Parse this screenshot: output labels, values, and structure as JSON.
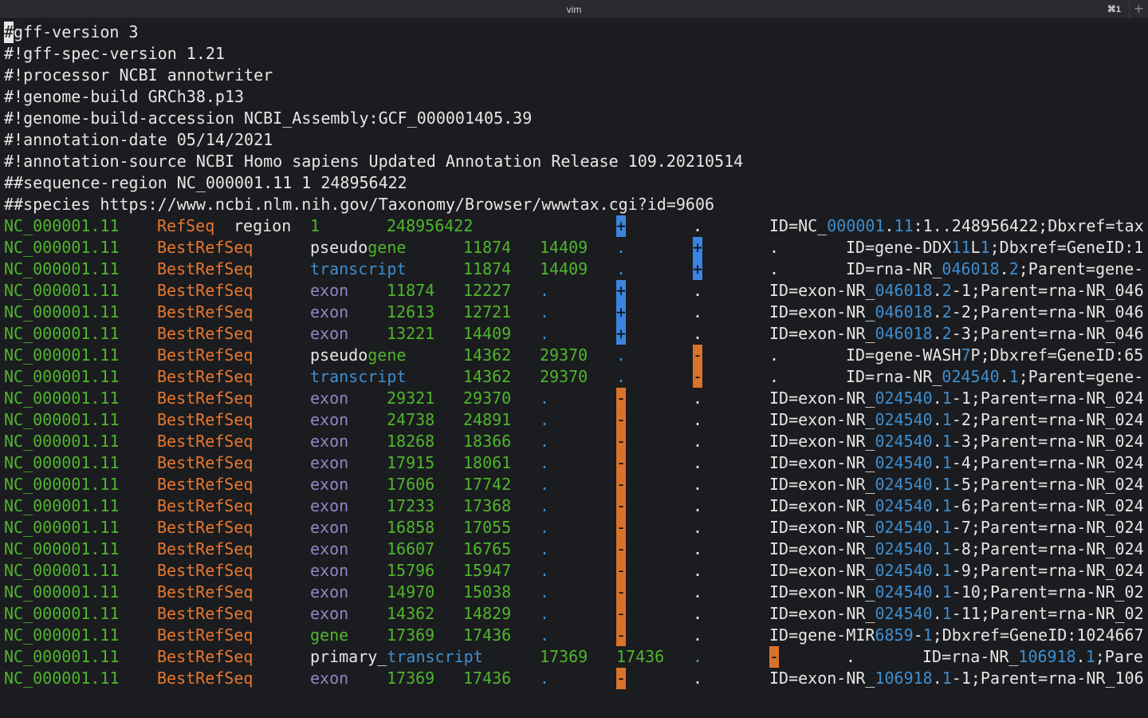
{
  "window": {
    "title": "vim",
    "shortcut": "⌘1",
    "newtab": "+"
  },
  "header_lines": [
    "#gff-version 3",
    "#!gff-spec-version 1.21",
    "#!processor NCBI annotwriter",
    "#!genome-build GRCh38.p13",
    "#!genome-build-accession NCBI_Assembly:GCF_000001405.39",
    "#!annotation-date 05/14/2021",
    "#!annotation-source NCBI Homo sapiens Updated Annotation Release 109.20210514",
    "##sequence-region NC_000001.11 1 248956422",
    "##species https://www.ncbi.nlm.nih.gov/Taxonomy/Browser/wwwtax.cgi?id=9606"
  ],
  "cursor_char": "#",
  "rows": [
    {
      "seqid": "NC_000001.11",
      "source": "RefSeq",
      "type": "region",
      "start": "1",
      "end": "248956422",
      "score": ".",
      "strand": "+",
      "phase": ".",
      "attr_pre": "ID=NC_",
      "attr_num": "000001",
      "attr_mid": ".",
      "attr_num2": "11",
      "attr_post": ":1..248956422;Dbxref=tax",
      "layout": "region"
    },
    {
      "seqid": "NC_000001.11",
      "source": "BestRefSeq",
      "type": "pseudogene",
      "start": "11874",
      "end": "14409",
      "score": ".",
      "strand": "+",
      "phase": ".",
      "attr_pre": "ID=gene-DDX",
      "attr_num": "11",
      "attr_mid": "L",
      "attr_num2": "1",
      "attr_post": ";Dbxref=GeneID:1",
      "layout": "gene"
    },
    {
      "seqid": "NC_000001.11",
      "source": "BestRefSeq",
      "type": "transcript",
      "start": "11874",
      "end": "14409",
      "score": ".",
      "strand": "+",
      "phase": ".",
      "attr_pre": "ID=rna-NR_",
      "attr_num": "046018",
      "attr_mid": ".",
      "attr_num2": "2",
      "attr_post": ";Parent=gene-",
      "layout": "gene"
    },
    {
      "seqid": "NC_000001.11",
      "source": "BestRefSeq",
      "type": "exon",
      "start": "11874",
      "end": "12227",
      "score": ".",
      "strand": "+",
      "phase": ".",
      "attr_pre": "ID=exon-NR_",
      "attr_num": "046018",
      "attr_mid": ".",
      "attr_num2": "2",
      "attr_post": "-1;Parent=rna-NR_046",
      "layout": "exon"
    },
    {
      "seqid": "NC_000001.11",
      "source": "BestRefSeq",
      "type": "exon",
      "start": "12613",
      "end": "12721",
      "score": ".",
      "strand": "+",
      "phase": ".",
      "attr_pre": "ID=exon-NR_",
      "attr_num": "046018",
      "attr_mid": ".",
      "attr_num2": "2",
      "attr_post": "-2;Parent=rna-NR_046",
      "layout": "exon"
    },
    {
      "seqid": "NC_000001.11",
      "source": "BestRefSeq",
      "type": "exon",
      "start": "13221",
      "end": "14409",
      "score": ".",
      "strand": "+",
      "phase": ".",
      "attr_pre": "ID=exon-NR_",
      "attr_num": "046018",
      "attr_mid": ".",
      "attr_num2": "2",
      "attr_post": "-3;Parent=rna-NR_046",
      "layout": "exon"
    },
    {
      "seqid": "NC_000001.11",
      "source": "BestRefSeq",
      "type": "pseudogene",
      "start": "14362",
      "end": "29370",
      "score": ".",
      "strand": "-",
      "phase": ".",
      "attr_pre": "ID=gene-WASH",
      "attr_num": "7",
      "attr_mid": "P",
      "attr_num2": "",
      "attr_post": ";Dbxref=GeneID:65",
      "layout": "gene"
    },
    {
      "seqid": "NC_000001.11",
      "source": "BestRefSeq",
      "type": "transcript",
      "start": "14362",
      "end": "29370",
      "score": ".",
      "strand": "-",
      "phase": ".",
      "attr_pre": "ID=rna-NR_",
      "attr_num": "024540",
      "attr_mid": ".",
      "attr_num2": "1",
      "attr_post": ";Parent=gene-",
      "layout": "gene"
    },
    {
      "seqid": "NC_000001.11",
      "source": "BestRefSeq",
      "type": "exon",
      "start": "29321",
      "end": "29370",
      "score": ".",
      "strand": "-",
      "phase": ".",
      "attr_pre": "ID=exon-NR_",
      "attr_num": "024540",
      "attr_mid": ".",
      "attr_num2": "1",
      "attr_post": "-1;Parent=rna-NR_024",
      "layout": "exon"
    },
    {
      "seqid": "NC_000001.11",
      "source": "BestRefSeq",
      "type": "exon",
      "start": "24738",
      "end": "24891",
      "score": ".",
      "strand": "-",
      "phase": ".",
      "attr_pre": "ID=exon-NR_",
      "attr_num": "024540",
      "attr_mid": ".",
      "attr_num2": "1",
      "attr_post": "-2;Parent=rna-NR_024",
      "layout": "exon"
    },
    {
      "seqid": "NC_000001.11",
      "source": "BestRefSeq",
      "type": "exon",
      "start": "18268",
      "end": "18366",
      "score": ".",
      "strand": "-",
      "phase": ".",
      "attr_pre": "ID=exon-NR_",
      "attr_num": "024540",
      "attr_mid": ".",
      "attr_num2": "1",
      "attr_post": "-3;Parent=rna-NR_024",
      "layout": "exon"
    },
    {
      "seqid": "NC_000001.11",
      "source": "BestRefSeq",
      "type": "exon",
      "start": "17915",
      "end": "18061",
      "score": ".",
      "strand": "-",
      "phase": ".",
      "attr_pre": "ID=exon-NR_",
      "attr_num": "024540",
      "attr_mid": ".",
      "attr_num2": "1",
      "attr_post": "-4;Parent=rna-NR_024",
      "layout": "exon"
    },
    {
      "seqid": "NC_000001.11",
      "source": "BestRefSeq",
      "type": "exon",
      "start": "17606",
      "end": "17742",
      "score": ".",
      "strand": "-",
      "phase": ".",
      "attr_pre": "ID=exon-NR_",
      "attr_num": "024540",
      "attr_mid": ".",
      "attr_num2": "1",
      "attr_post": "-5;Parent=rna-NR_024",
      "layout": "exon"
    },
    {
      "seqid": "NC_000001.11",
      "source": "BestRefSeq",
      "type": "exon",
      "start": "17233",
      "end": "17368",
      "score": ".",
      "strand": "-",
      "phase": ".",
      "attr_pre": "ID=exon-NR_",
      "attr_num": "024540",
      "attr_mid": ".",
      "attr_num2": "1",
      "attr_post": "-6;Parent=rna-NR_024",
      "layout": "exon"
    },
    {
      "seqid": "NC_000001.11",
      "source": "BestRefSeq",
      "type": "exon",
      "start": "16858",
      "end": "17055",
      "score": ".",
      "strand": "-",
      "phase": ".",
      "attr_pre": "ID=exon-NR_",
      "attr_num": "024540",
      "attr_mid": ".",
      "attr_num2": "1",
      "attr_post": "-7;Parent=rna-NR_024",
      "layout": "exon"
    },
    {
      "seqid": "NC_000001.11",
      "source": "BestRefSeq",
      "type": "exon",
      "start": "16607",
      "end": "16765",
      "score": ".",
      "strand": "-",
      "phase": ".",
      "attr_pre": "ID=exon-NR_",
      "attr_num": "024540",
      "attr_mid": ".",
      "attr_num2": "1",
      "attr_post": "-8;Parent=rna-NR_024",
      "layout": "exon"
    },
    {
      "seqid": "NC_000001.11",
      "source": "BestRefSeq",
      "type": "exon",
      "start": "15796",
      "end": "15947",
      "score": ".",
      "strand": "-",
      "phase": ".",
      "attr_pre": "ID=exon-NR_",
      "attr_num": "024540",
      "attr_mid": ".",
      "attr_num2": "1",
      "attr_post": "-9;Parent=rna-NR_024",
      "layout": "exon"
    },
    {
      "seqid": "NC_000001.11",
      "source": "BestRefSeq",
      "type": "exon",
      "start": "14970",
      "end": "15038",
      "score": ".",
      "strand": "-",
      "phase": ".",
      "attr_pre": "ID=exon-NR_",
      "attr_num": "024540",
      "attr_mid": ".",
      "attr_num2": "1",
      "attr_post": "-10;Parent=rna-NR_02",
      "layout": "exon"
    },
    {
      "seqid": "NC_000001.11",
      "source": "BestRefSeq",
      "type": "exon",
      "start": "14362",
      "end": "14829",
      "score": ".",
      "strand": "-",
      "phase": ".",
      "attr_pre": "ID=exon-NR_",
      "attr_num": "024540",
      "attr_mid": ".",
      "attr_num2": "1",
      "attr_post": "-11;Parent=rna-NR_02",
      "layout": "exon"
    },
    {
      "seqid": "NC_000001.11",
      "source": "BestRefSeq",
      "type": "gene",
      "start": "17369",
      "end": "17436",
      "score": ".",
      "strand": "-",
      "phase": ".",
      "attr_pre": "ID=gene-MIR",
      "attr_num": "6859",
      "attr_mid": "-",
      "attr_num2": "1",
      "attr_post": ";Dbxref=GeneID:1024667",
      "layout": "exon"
    },
    {
      "seqid": "NC_000001.11",
      "source": "BestRefSeq",
      "type": "primary_transcript",
      "start": "17369",
      "end": "17436",
      "score": ".",
      "strand": "-",
      "phase": ".",
      "attr_pre": "ID=rna-NR_",
      "attr_num": "106918",
      "attr_mid": ".",
      "attr_num2": "1",
      "attr_post": ";Pare",
      "layout": "primary"
    },
    {
      "seqid": "NC_000001.11",
      "source": "BestRefSeq",
      "type": "exon",
      "start": "17369",
      "end": "17436",
      "score": ".",
      "strand": "-",
      "phase": ".",
      "attr_pre": "ID=exon-NR_",
      "attr_num": "106918",
      "attr_mid": ".",
      "attr_num2": "1",
      "attr_post": "-1;Parent=rna-NR_106",
      "layout": "exon"
    }
  ]
}
